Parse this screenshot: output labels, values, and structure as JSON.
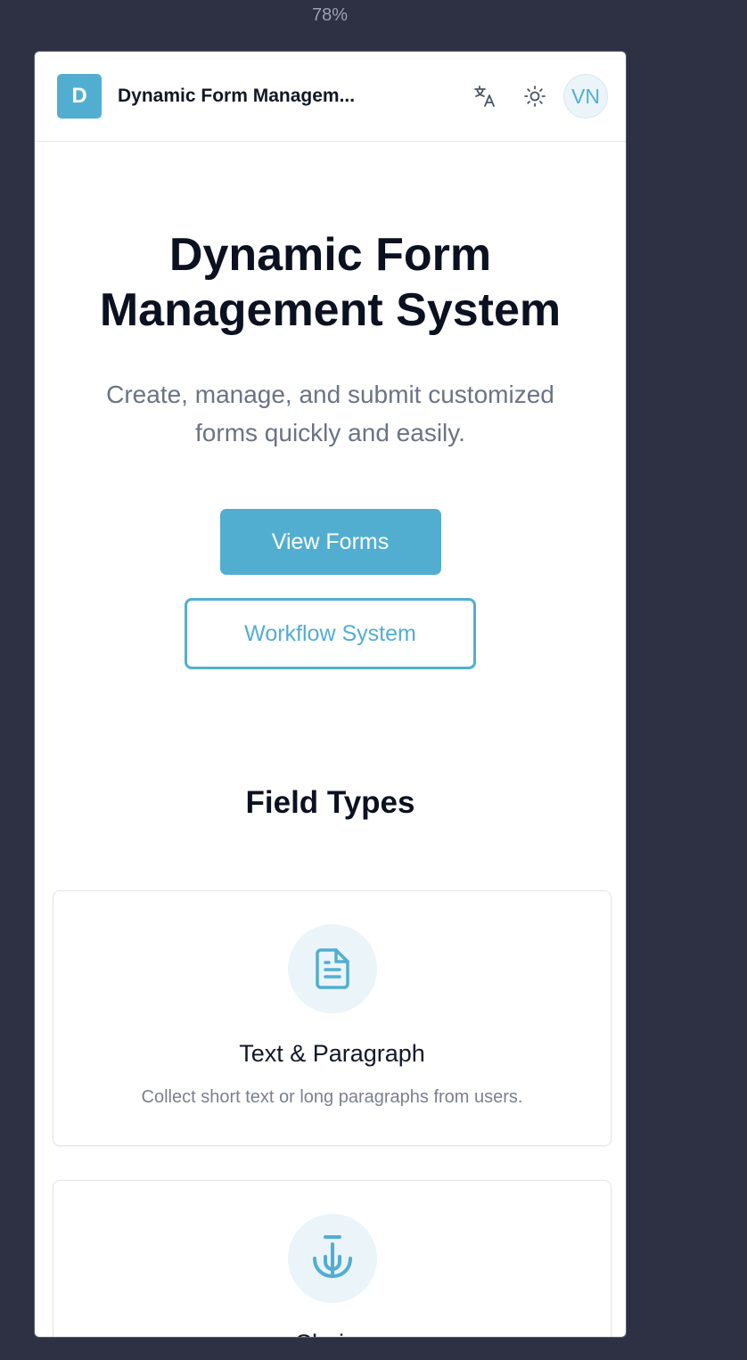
{
  "browser": {
    "zoom": "78%"
  },
  "header": {
    "logo_letter": "D",
    "title": "Dynamic Form Managem...",
    "avatar_initials": "VN"
  },
  "hero": {
    "title": "Dynamic Form Management System",
    "subtitle": "Create, manage, and submit customized forms quickly and easily.",
    "primary_button": "View Forms",
    "secondary_button": "Workflow System"
  },
  "field_types": {
    "title": "Field Types",
    "cards": [
      {
        "icon": "document-text-icon",
        "title": "Text & Paragraph",
        "description": "Collect short text or long paragraphs from users."
      },
      {
        "icon": "choice-icon",
        "title": "Choice",
        "description": ""
      }
    ]
  },
  "colors": {
    "accent": "#52aed1",
    "background": "#2d3143"
  }
}
